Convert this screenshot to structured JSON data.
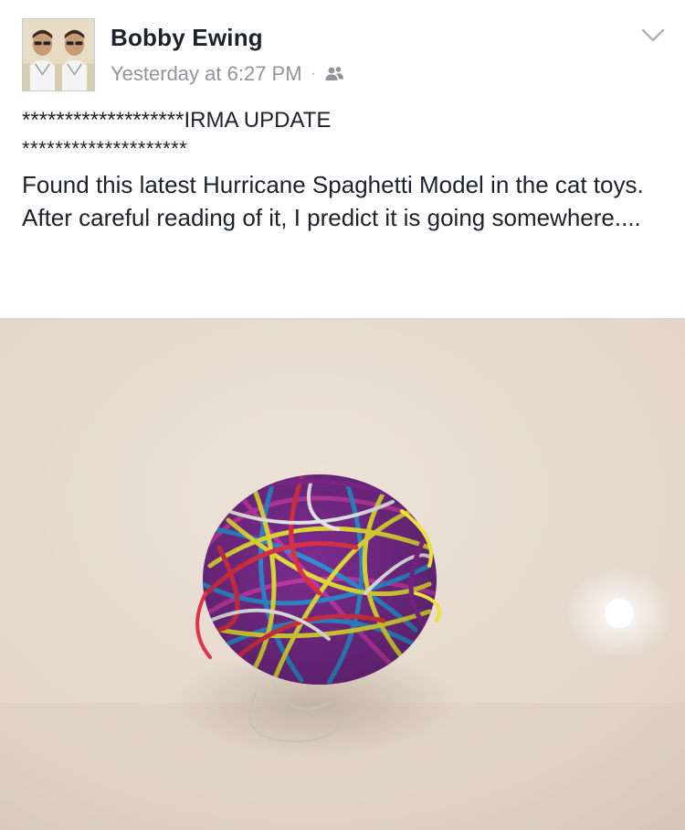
{
  "post": {
    "author": "Bobby Ewing",
    "timestamp": "Yesterday at 6:27 PM",
    "separator": "·",
    "audience_icon": "friends-icon",
    "menu_icon": "chevron-down-icon",
    "text_line_1": "*******************IRMA UPDATE",
    "text_line_2": "********************",
    "text_body_1": "Found this latest Hurricane Spaghetti Model in the cat toys.",
    "text_body_2": "After careful reading of it, I predict it is going somewhere...."
  },
  "colors": {
    "text_primary": "#1d2129",
    "text_secondary": "#90949c",
    "photo_background": "#e8ddd2"
  },
  "photo": {
    "subject": "ball of multicolored yarn",
    "yarn_colors": [
      "#8e2a9e",
      "#e9e23a",
      "#2e8fd6",
      "#e03248",
      "#f2f2f2"
    ]
  }
}
